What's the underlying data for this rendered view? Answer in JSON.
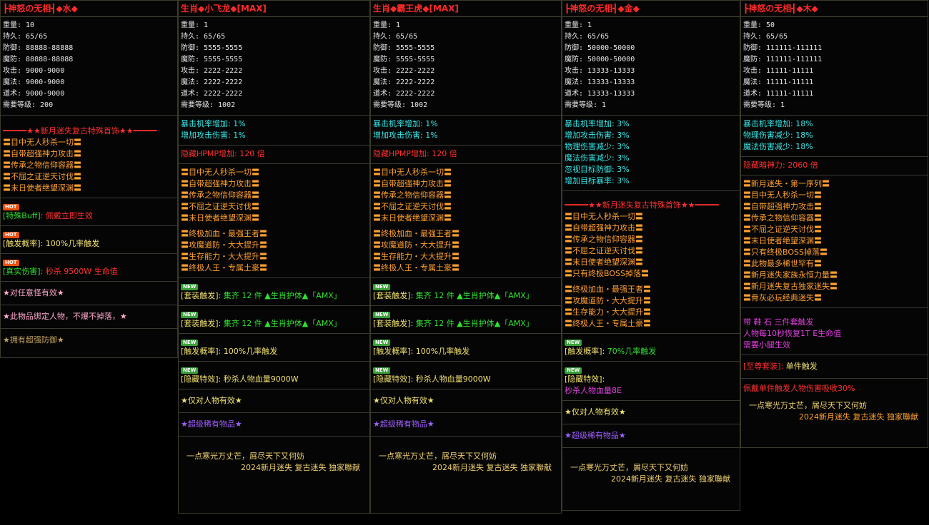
{
  "colors": {
    "red": "#ff3030",
    "cyan": "#38e8e8",
    "yellow": "#f0e070",
    "orange": "#ffa030",
    "green": "#30e030",
    "magenta": "#e040e0",
    "purple": "#a060ff"
  },
  "panels": [
    {
      "title": "┣神怒の无相┫◆水◆",
      "stats": [
        "重量: 10",
        "持久: 65/65",
        "防御: 88888-88888",
        "魔防: 88888-88888",
        "攻击: 9000-9000",
        "魔法: 9000-9000",
        "道术: 9000-9000",
        "需要等级: 200"
      ],
      "banner": "━━━━━★★新月迷失复古特殊首饰★★━━━━━",
      "perks": [
        "〓目中无人秒杀一切〓",
        "〓自带超强神力攻击〓",
        "〓传承之物信仰容器〓",
        "〓不屈之证逆天讨伐〓",
        "〓末日使者绝望深渊〓"
      ],
      "hot": [
        {
          "badge": "HOT",
          "label": "[特殊Buff]:",
          "value": "佩戴立即生效"
        },
        {
          "badge": "HOT",
          "label": "[触发概率]:",
          "value": "100%几率触发"
        },
        {
          "badge": "HOT",
          "label": "[真实伤害]:",
          "value": "秒杀 9500W 生命值"
        }
      ],
      "notes": [
        "★对任意怪有效★",
        "★此物品绑定人物，不爆不掉落，★",
        "★拥有超强防御★"
      ]
    },
    {
      "title": "生肖◆小飞龙◆[MAX]",
      "stats": [
        "重量: 1",
        "持久: 65/65",
        "防御: 5555-5555",
        "魔防: 5555-5555",
        "攻击: 2222-2222",
        "魔法: 2222-2222",
        "道术: 2222-2222",
        "需要等级: 1002"
      ],
      "bonus": [
        "暴击机率增加: 1%",
        "增加攻击伤害: 1%"
      ],
      "hidden": "隐藏HPMP增加: 120 倍",
      "perks": [
        "〓目中无人秒杀一切〓",
        "〓自带超强神力攻击〓",
        "〓传承之物信仰容器〓",
        "〓不屈之证逆天讨伐〓",
        "〓末日使者绝望深渊〓"
      ],
      "perks2": [
        "〓终极加血・最强王者〓",
        "〓攻魔道防・大大提升〓",
        "〓生存能力・大大提升〓",
        "〓终极人王・专属土豪〓"
      ],
      "sets": [
        {
          "badge": "NEW",
          "label": "[套装触发]:",
          "value": "集齐 12 件 ▲生肖护体▲「AMX」"
        },
        {
          "badge": "NEW",
          "label": "[套装触发]:",
          "value": "集齐 12 件 ▲生肖护体▲「AMX」"
        }
      ],
      "news": [
        {
          "badge": "NEW",
          "label": "[触发概率]:",
          "value": "100%几率触发"
        },
        {
          "badge": "NEW",
          "label": "[隐藏特效]:",
          "value": "秒杀人物血量9000W"
        }
      ],
      "notes": [
        "★仅对人物有效★",
        "★超级稀有物品★"
      ],
      "footer1": "一点寒光万丈芒，屑尽天下又何妨",
      "footer2": "2024新月迷失  复古迷失  独家聯献"
    },
    {
      "title": "生肖◆霸王虎◆[MAX]",
      "stats": [
        "重量: 1",
        "持久: 65/65",
        "防御: 5555-5555",
        "魔防: 5555-5555",
        "攻击: 2222-2222",
        "魔法: 2222-2222",
        "道术: 2222-2222",
        "需要等级: 1002"
      ],
      "bonus": [
        "暴击机率增加: 1%",
        "增加攻击伤害: 1%"
      ],
      "hidden": "隐藏HPMP增加: 120 倍",
      "perks": [
        "〓目中无人秒杀一切〓",
        "〓自带超强神力攻击〓",
        "〓传承之物信仰容器〓",
        "〓不屈之证逆天讨伐〓",
        "〓末日使者绝望深渊〓"
      ],
      "perks2": [
        "〓终极加血・最强王者〓",
        "〓攻魔道防・大大提升〓",
        "〓生存能力・大大提升〓",
        "〓终极人王・专属土豪〓"
      ],
      "sets": [
        {
          "badge": "NEW",
          "label": "[套装触发]:",
          "value": "集齐 12 件 ▲生肖护体▲「AMX」"
        },
        {
          "badge": "NEW",
          "label": "[套装触发]:",
          "value": "集齐 12 件 ▲生肖护体▲「AMX」"
        }
      ],
      "news": [
        {
          "badge": "NEW",
          "label": "[触发概率]:",
          "value": "100%几率触发"
        },
        {
          "badge": "NEW",
          "label": "[隐藏特效]:",
          "value": "秒杀人物血量9000W"
        }
      ],
      "notes": [
        "★仅对人物有效★",
        "★超级稀有物品★"
      ],
      "footer1": "一点寒光万丈芒，屑尽天下又何妨",
      "footer2": "2024新月迷失  复古迷失  独家聯献"
    },
    {
      "title": "┣神怒の无相┫◆金◆",
      "stats": [
        "重量: 1",
        "持久: 65/65",
        "防御: 50000-50000",
        "魔防: 50000-50000",
        "攻击: 13333-13333",
        "魔法: 13333-13333",
        "道术: 13333-13333",
        "需要等级: 1"
      ],
      "bonus": [
        "暴击机率增加: 3%",
        "增加攻击伤害: 3%",
        "物理伤害减少: 3%",
        "魔法伤害减少: 3%",
        "忽视目标防御: 3%",
        "增加目标暴率: 3%"
      ],
      "banner": "━━━━━★★新月迷失复古特殊首饰★★━━━━━",
      "perks": [
        "〓目中无人秒杀一切〓",
        "〓自带超强神力攻击〓",
        "〓传承之物信仰容器〓",
        "〓不屈之证逆天讨伐〓",
        "〓末日使者绝望深渊〓",
        "〓只有终极BOSS掉落〓"
      ],
      "perks2": [
        "〓终极加血・最强王者〓",
        "〓攻魔道防・大大提升〓",
        "〓生存能力・大大提升〓",
        "〓终极人王・专属土豪〓"
      ],
      "news": [
        {
          "badge": "NEW",
          "label": "[触发概率]:",
          "value": "70%几率触发"
        },
        {
          "badge": "NEW",
          "label": "[隐藏特效]:",
          "value": "秒杀人物血量8E"
        }
      ],
      "notes": [
        "★仅对人物有效★",
        "★超级稀有物品★"
      ],
      "footer1": "一点寒光万丈芒，屑尽天下又何妨",
      "footer2": "2024新月迷失  复古迷失  独家聯献"
    },
    {
      "title": "┣神怒の无相┫◆木◆",
      "stats": [
        "重量: 50",
        "持久: 65/65",
        "防御: 111111-111111",
        "魔防: 111111-111111",
        "攻击: 11111-11111",
        "魔法: 11111-11111",
        "道术: 11111-11111",
        "需要等级: 1"
      ],
      "bonus": [
        "暴击机率增加: 18%",
        "物理伤害减少: 18%",
        "魔法伤害减少: 18%"
      ],
      "hidden": "隐藏暗神力: 2060 倍",
      "perks": [
        "〓新月迷失・第一序列〓",
        "〓目中无人秒杀一切〓",
        "〓自带超强神力攻击〓",
        "〓传承之物信仰容器〓",
        "〓不屈之证逆天讨伐〓",
        "〓末日使者绝望深渊〓",
        "〓只有终极BOSS掉落〓",
        "〓此物最多稀世罕有〓",
        "〓新月迷失家族永恒力量〓",
        "〓新月迷失复古独家迷失〓",
        "〓骨灰必玩经典迷失〓"
      ],
      "setinfo": [
        "带 鞋 石 三件套触发",
        "人物每10秒恢复1T E生命值",
        "需要小腿生效"
      ],
      "supreme": {
        "label": "[至尊套装]:",
        "value": "单件触发"
      },
      "supreme_note": "佩戴单件触发人物伤害吸收30%",
      "footer1": "一点寒光万丈芒，屑尽天下又何妨",
      "footer2": "2024新月迷失  复古迷失  独家聯献"
    }
  ]
}
